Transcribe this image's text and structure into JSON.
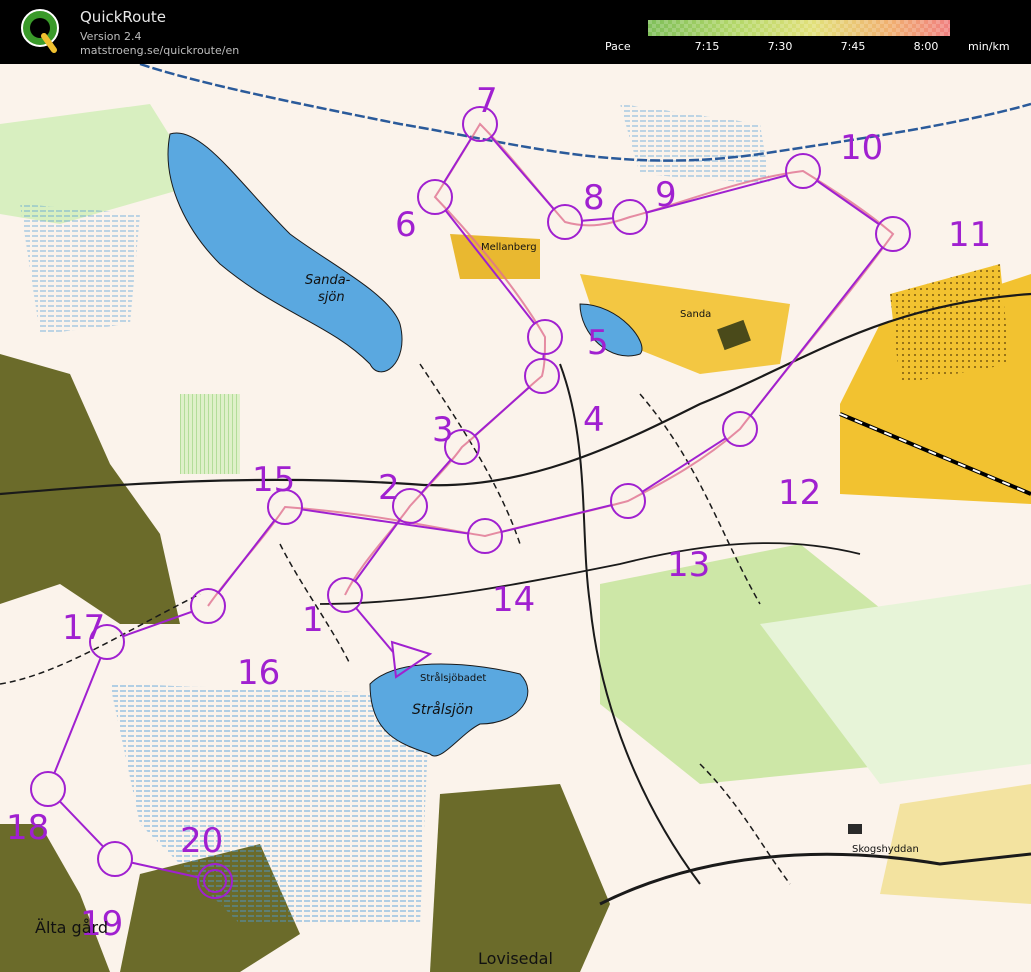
{
  "app": {
    "title": "QuickRoute",
    "version": "Version 2.4",
    "url": "matstroeng.se/quickroute/en"
  },
  "pace_legend": {
    "label": "Pace",
    "ticks": [
      "7:15",
      "7:30",
      "7:45",
      "8:00"
    ],
    "unit": "min/km",
    "colors": [
      "#7fbf5a",
      "#b5d86a",
      "#e2e07a",
      "#f0b070",
      "#f08080"
    ]
  },
  "map_labels": {
    "sandasjon": "Sanda-\nsjön",
    "mellanberg": "Mellanberg",
    "sanda": "Sanda",
    "stralsjobadet": "Strålsjöbadet",
    "stralsjon": "Strålsjön",
    "skogshyddan": "Skogshyddan",
    "alta_gard": "Älta gård",
    "lovisedal": "Lovisedal"
  },
  "controls": [
    {
      "number": "1"
    },
    {
      "number": "2"
    },
    {
      "number": "3"
    },
    {
      "number": "4"
    },
    {
      "number": "5"
    },
    {
      "number": "6"
    },
    {
      "number": "7"
    },
    {
      "number": "8"
    },
    {
      "number": "9"
    },
    {
      "number": "10"
    },
    {
      "number": "11"
    },
    {
      "number": "12"
    },
    {
      "number": "13"
    },
    {
      "number": "14"
    },
    {
      "number": "15"
    },
    {
      "number": "16"
    },
    {
      "number": "17"
    },
    {
      "number": "18"
    },
    {
      "number": "19"
    },
    {
      "number": "20"
    }
  ],
  "colors": {
    "course": "#a020d0",
    "water": "#5aa8e0",
    "open_yellow": "#f2c230",
    "light_green": "#c8e6a0",
    "urban": "#6b6b2a"
  }
}
